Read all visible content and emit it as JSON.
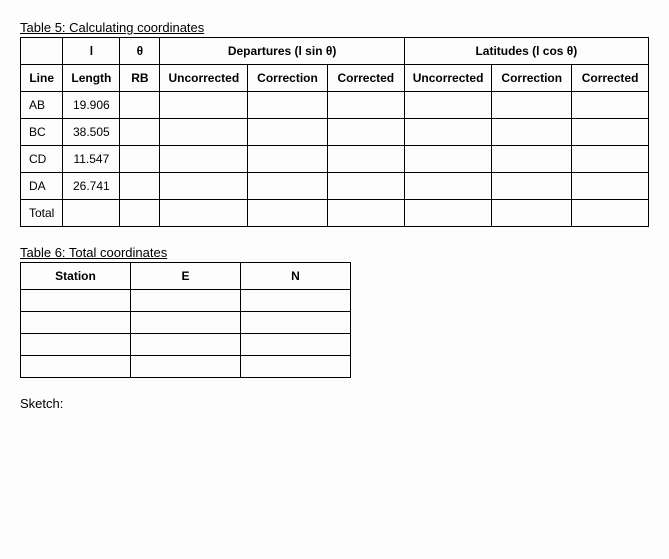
{
  "table5": {
    "title": "Table 5: Calculating coordinates",
    "header_top": {
      "l": "l",
      "theta": "θ",
      "departures": "Departures (l sin θ)",
      "latitudes": "Latitudes (l cos θ)"
    },
    "header_sub": {
      "line": "Line",
      "length": "Length",
      "rb": "RB",
      "uncorrected": "Uncorrected",
      "correction": "Correction",
      "corrected": "Corrected"
    },
    "rows": [
      {
        "line": "AB",
        "length": "19.906"
      },
      {
        "line": "BC",
        "length": "38.505"
      },
      {
        "line": "CD",
        "length": "11.547"
      },
      {
        "line": "DA",
        "length": "26.741"
      },
      {
        "line": "Total",
        "length": ""
      }
    ]
  },
  "table6": {
    "title": "Table 6: Total coordinates",
    "header": {
      "station": "Station",
      "e": "E",
      "n": "N"
    },
    "rows": [
      {
        "station": "",
        "e": "",
        "n": ""
      },
      {
        "station": "",
        "e": "",
        "n": ""
      },
      {
        "station": "",
        "e": "",
        "n": ""
      },
      {
        "station": "",
        "e": "",
        "n": ""
      }
    ]
  },
  "sketch_label": "Sketch:"
}
